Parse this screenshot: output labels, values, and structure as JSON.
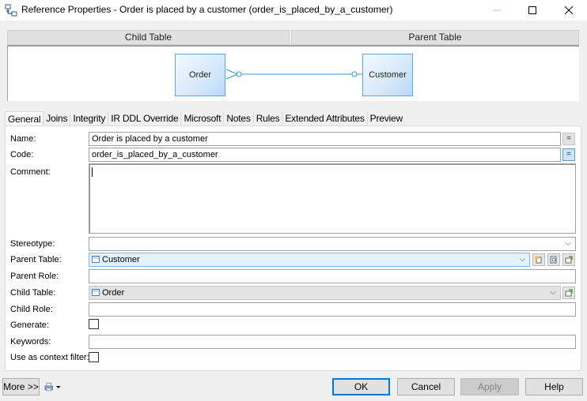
{
  "window": {
    "title": "Reference Properties - Order is placed by a customer (order_is_placed_by_a_customer)",
    "icon": "reference-icon",
    "controls": [
      "minimize-icon",
      "maximize-icon",
      "close-icon"
    ]
  },
  "diagram": {
    "child_header": "Child Table",
    "parent_header": "Parent Table",
    "child_entity": "Order",
    "parent_entity": "Customer",
    "line_color": "#3c97d3"
  },
  "tabs": [
    {
      "label": "General",
      "active": true
    },
    {
      "label": "Joins"
    },
    {
      "label": "Integrity"
    },
    {
      "label": "IR DDL Override"
    },
    {
      "label": "Microsoft"
    },
    {
      "label": "Notes"
    },
    {
      "label": "Rules"
    },
    {
      "label": "Extended Attributes"
    },
    {
      "label": "Preview"
    }
  ],
  "form": {
    "name_label": "Name:",
    "name_value": "Order is placed by a customer",
    "code_label": "Code:",
    "code_value": "order_is_placed_by_a_customer",
    "equal_symbol": "=",
    "comment_label": "Comment:",
    "comment_value": "",
    "stereotype_label": "Stereotype:",
    "stereotype_value": "",
    "parent_table_label": "Parent Table:",
    "parent_table_value": "Customer",
    "parent_role_label": "Parent Role:",
    "parent_role_value": "",
    "child_table_label": "Child Table:",
    "child_table_value": "Order",
    "child_role_label": "Child Role:",
    "child_role_value": "",
    "generate_label": "Generate:",
    "generate_checked": false,
    "keywords_label": "Keywords:",
    "keywords_value": "",
    "context_filter_label": "Use as context filter:",
    "context_filter_checked": false,
    "chevron": "⌵"
  },
  "footer": {
    "more_label": "More >>",
    "ok_label": "OK",
    "cancel_label": "Cancel",
    "apply_label": "Apply",
    "help_label": "Help"
  }
}
